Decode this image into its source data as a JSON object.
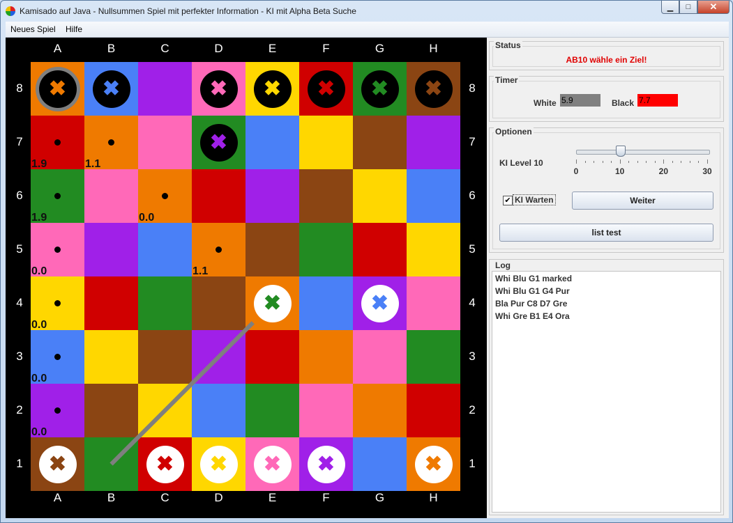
{
  "window": {
    "title": "Kamisado auf Java - Nullsummen Spiel mit perfekter Information - KI mit Alpha Beta Suche"
  },
  "menu": {
    "items": [
      "Neues Spiel",
      "Hilfe"
    ]
  },
  "board": {
    "columns": [
      "A",
      "B",
      "C",
      "D",
      "E",
      "F",
      "G",
      "H"
    ],
    "rows": [
      "8",
      "7",
      "6",
      "5",
      "4",
      "3",
      "2",
      "1"
    ],
    "cell_colors": [
      [
        "#EF7A00",
        "#4A80F7",
        "#A020E8",
        "#FF69B8",
        "#FFD700",
        "#D00000",
        "#228B22",
        "#8B4513"
      ],
      [
        "#D00000",
        "#EF7A00",
        "#FF69B8",
        "#228B22",
        "#4A80F7",
        "#FFD700",
        "#8B4513",
        "#A020E8"
      ],
      [
        "#228B22",
        "#FF69B8",
        "#EF7A00",
        "#D00000",
        "#A020E8",
        "#8B4513",
        "#FFD700",
        "#4A80F7"
      ],
      [
        "#FF69B8",
        "#A020E8",
        "#4A80F7",
        "#EF7A00",
        "#8B4513",
        "#228B22",
        "#D00000",
        "#FFD700"
      ],
      [
        "#FFD700",
        "#D00000",
        "#228B22",
        "#8B4513",
        "#EF7A00",
        "#4A80F7",
        "#A020E8",
        "#FF69B8"
      ],
      [
        "#4A80F7",
        "#FFD700",
        "#8B4513",
        "#A020E8",
        "#D00000",
        "#EF7A00",
        "#FF69B8",
        "#228B22"
      ],
      [
        "#A020E8",
        "#8B4513",
        "#FFD700",
        "#4A80F7",
        "#228B22",
        "#FF69B8",
        "#EF7A00",
        "#D00000"
      ],
      [
        "#8B4513",
        "#228B22",
        "#D00000",
        "#FFD700",
        "#FF69B8",
        "#A020E8",
        "#4A80F7",
        "#EF7A00"
      ]
    ],
    "towers": [
      {
        "cell": "A8",
        "side": "black",
        "color": "#EF7A00",
        "selected": true
      },
      {
        "cell": "B8",
        "side": "black",
        "color": "#4A80F7"
      },
      {
        "cell": "D8",
        "side": "black",
        "color": "#FF69B8"
      },
      {
        "cell": "E8",
        "side": "black",
        "color": "#FFD700"
      },
      {
        "cell": "F8",
        "side": "black",
        "color": "#D00000"
      },
      {
        "cell": "G8",
        "side": "black",
        "color": "#228B22"
      },
      {
        "cell": "H8",
        "side": "black",
        "color": "#8B4513"
      },
      {
        "cell": "D7",
        "side": "black",
        "color": "#A020E8"
      },
      {
        "cell": "E4",
        "side": "white",
        "color": "#228B22"
      },
      {
        "cell": "G4",
        "side": "white",
        "color": "#4A80F7"
      },
      {
        "cell": "A1",
        "side": "white",
        "color": "#8B4513"
      },
      {
        "cell": "C1",
        "side": "white",
        "color": "#D00000"
      },
      {
        "cell": "D1",
        "side": "white",
        "color": "#FFD700"
      },
      {
        "cell": "E1",
        "side": "white",
        "color": "#FF69B8"
      },
      {
        "cell": "F1",
        "side": "white",
        "color": "#A020E8"
      },
      {
        "cell": "H1",
        "side": "white",
        "color": "#EF7A00"
      }
    ],
    "move_targets": [
      {
        "cell": "A7",
        "score": "1.9"
      },
      {
        "cell": "B7",
        "score": "1.1"
      },
      {
        "cell": "A6",
        "score": "1.9"
      },
      {
        "cell": "C6",
        "score": "0.0"
      },
      {
        "cell": "A5",
        "score": "0.0"
      },
      {
        "cell": "D5",
        "score": "1.1"
      },
      {
        "cell": "A4",
        "score": "0.0"
      },
      {
        "cell": "A3",
        "score": "0.0"
      },
      {
        "cell": "A2",
        "score": "0.0"
      }
    ],
    "last_move": {
      "from": "B1",
      "to": "E4"
    }
  },
  "status": {
    "title": "Status",
    "text": "AB10 wähle ein Ziel!",
    "text_color": "#E00000"
  },
  "timer": {
    "title": "Timer",
    "white_label": "White",
    "white_value": "5.9",
    "black_label": "Black",
    "black_value": "7.7",
    "white_color": "#808080",
    "black_color": "#FF0000"
  },
  "options": {
    "title": "Optionen",
    "ki_level_label": "KI Level 10",
    "slider": {
      "value": 10,
      "min": 0,
      "max": 30,
      "tick_labels": [
        "0",
        "10",
        "20",
        "30"
      ]
    },
    "ki_warten_label": "KI Warten",
    "ki_warten_checked": true,
    "weiter_label": "Weiter",
    "list_test_label": "list test"
  },
  "log": {
    "title": "Log",
    "lines": [
      "Whi Blu G1 marked",
      "Whi Blu G1 G4 Pur",
      "Bla Pur C8 D7 Gre",
      "Whi Gre B1 E4 Ora"
    ]
  }
}
